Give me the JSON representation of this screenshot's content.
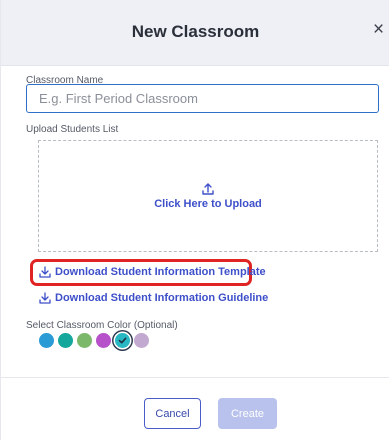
{
  "modal": {
    "title": "New Classroom",
    "close_symbol": "×"
  },
  "classroom_name": {
    "label": "Classroom Name",
    "placeholder": "E.g. First Period Classroom",
    "value": ""
  },
  "upload": {
    "label": "Upload Students List",
    "text": "Click Here to Upload",
    "icon": "upload-icon"
  },
  "links": {
    "template": "Download Student Information Template",
    "guideline": "Download Student Information Guideline",
    "icon": "download-icon"
  },
  "color_picker": {
    "label": "Select Classroom Color (Optional)",
    "colors": [
      "#2b9bd6",
      "#15a79c",
      "#7cb86a",
      "#b651c9",
      "#28b8c4",
      "#c2a9d0"
    ],
    "selected_index": 4
  },
  "footer": {
    "cancel_label": "Cancel",
    "create_label": "Create"
  },
  "theme": {
    "accent": "#3d4fc9",
    "highlight": "#e02424"
  }
}
